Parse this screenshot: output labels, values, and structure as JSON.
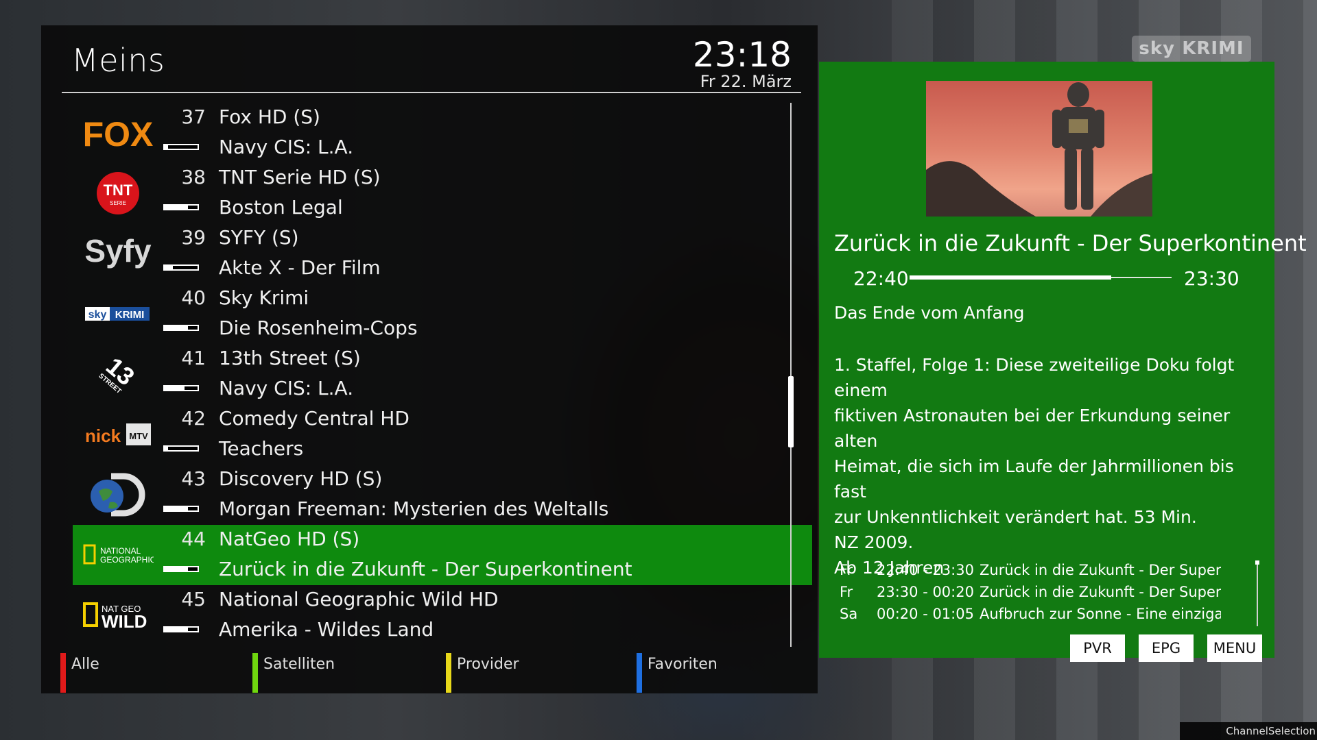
{
  "header": {
    "title": "Meins",
    "clock": "23:18",
    "date": "Fr 22. März"
  },
  "channels": [
    {
      "logo": "fox-logo",
      "number": "37",
      "name": "Fox HD (S)",
      "event": "Navy CIS: L.A.",
      "progress": 0.1
    },
    {
      "logo": "tnt-serie-logo",
      "number": "38",
      "name": "TNT Serie HD (S)",
      "event": "Boston Legal",
      "progress": 0.7
    },
    {
      "logo": "syfy-logo",
      "number": "39",
      "name": "SYFY (S)",
      "event": "Akte X - Der Film",
      "progress": 0.25
    },
    {
      "logo": "sky-krimi-logo",
      "number": "40",
      "name": "Sky Krimi",
      "event": "Die Rosenheim-Cops",
      "progress": 0.7
    },
    {
      "logo": "13th-street-logo",
      "number": "41",
      "name": "13th Street (S)",
      "event": "Navy CIS: L.A.",
      "progress": 0.6
    },
    {
      "logo": "nick-mtv-logo",
      "number": "42",
      "name": "Comedy Central HD",
      "event": "Teachers",
      "progress": 0.1
    },
    {
      "logo": "discovery-logo",
      "number": "43",
      "name": "Discovery HD (S)",
      "event": "Morgan Freeman: Mysterien des Weltalls",
      "progress": 0.7
    },
    {
      "logo": "national-geographic-logo",
      "number": "44",
      "name": "NatGeo HD (S)",
      "event": "Zurück in die Zukunft - Der Superkontinent",
      "progress": 0.7,
      "selected": true
    },
    {
      "logo": "nat-geo-wild-logo",
      "number": "45",
      "name": "National Geographic Wild HD",
      "event": "Amerika - Wildes Land",
      "progress": 0.7
    }
  ],
  "logo_text": {
    "fox": "FOX",
    "tnt": "TNT",
    "tnt_sub": "SERIE",
    "syfy": "Syfy",
    "sky": "sky",
    "krimi": "KRIMI",
    "street13": "13",
    "street_word": "STREET",
    "nick": "nick",
    "mtv": "MTV",
    "natgeo_1": "NATIONAL",
    "natgeo_2": "GEOGRAPHIC",
    "wild_1": "NAT GEO",
    "wild_2": "WILD"
  },
  "color_buttons": [
    {
      "label": "Alle",
      "color": "#e01a1a"
    },
    {
      "label": "Satelliten",
      "color": "#6fd60f"
    },
    {
      "label": "Provider",
      "color": "#e8d81a"
    },
    {
      "label": "Favoriten",
      "color": "#1e6fe0"
    }
  ],
  "info": {
    "title": "Zurück in die Zukunft - Der Superkontinent",
    "start": "22:40",
    "end": "23:30",
    "progress": 0.77,
    "subtitle": "Das Ende vom Anfang",
    "description": [
      "1. Staffel, Folge 1: Diese zweiteilige Doku folgt einem",
      "fiktiven Astronauten bei der Erkundung seiner alten",
      "Heimat, die sich im Laufe der Jahrmillionen bis fast",
      "zur Unkenntlichkeit verändert hat. 53 Min.",
      "NZ 2009.",
      "Ab 12 Jahren"
    ],
    "epg": [
      {
        "day": "Fr",
        "time": "22:40 - 23:30",
        "title": "Zurück in die Zukunft - Der Superkontinent"
      },
      {
        "day": "Fr",
        "time": "23:30 - 00:20",
        "title": "Zurück in die Zukunft - Der Superkontinent"
      },
      {
        "day": "Sa",
        "time": "00:20 - 01:05",
        "title": "Aufbruch zur Sonne - Eine einzigartige"
      }
    ],
    "keys": {
      "pvr": "PVR",
      "epg": "EPG",
      "menu": "MENU"
    }
  },
  "screen_name": "ChannelSelection",
  "watermark": {
    "sky": "sky",
    "krimi": "KRIMI"
  },
  "colors": {
    "accent_green": "#0e8a0e",
    "info_green": "#127a12",
    "panel_bg": "#0a0a0a"
  }
}
